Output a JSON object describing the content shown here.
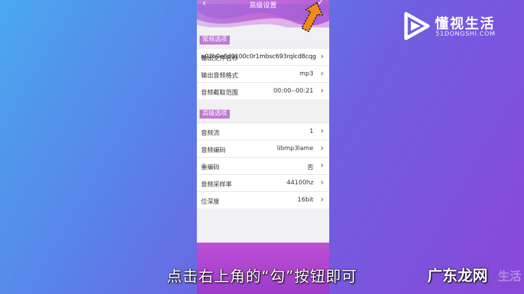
{
  "header": {
    "title": "高级设置",
    "back_icon": "chevron-left-icon",
    "confirm_icon": "checkmark-icon"
  },
  "general": {
    "tag": "常规选项",
    "rows": [
      {
        "label": "输出文件名称",
        "value": "",
        "overlay": "a02b0e8d0100c0r1mbsc693rqlcd8cqg"
      },
      {
        "label": "输出音频格式",
        "value": "mp3"
      },
      {
        "label": "音频截取范围",
        "value": "00:00--00:21"
      }
    ]
  },
  "advanced": {
    "tag": "高级选项",
    "rows": [
      {
        "label": "音频流",
        "value": "1"
      },
      {
        "label": "音频编码",
        "value": "libmp3lame"
      },
      {
        "label": "重编码",
        "value": "否"
      },
      {
        "label": "音频采样率",
        "value": "44100hz"
      },
      {
        "label": "位深度",
        "value": "16bit"
      }
    ]
  },
  "logo": {
    "name": "懂视生活",
    "domain": "51DONGSHI.COM"
  },
  "subtitle": "点击右上角的“勾”按钮即可",
  "brand_bottom": "广东龙网",
  "watermark_bottom": "生活",
  "colors": {
    "accent": "#c07ad4",
    "arrow": "#f08a1c"
  }
}
